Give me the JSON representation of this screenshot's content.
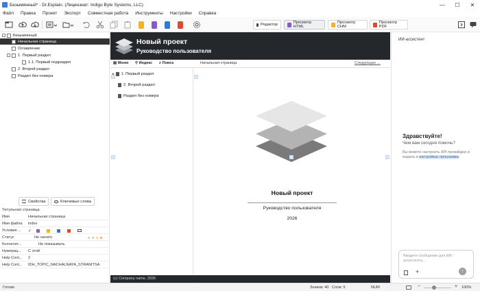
{
  "window": {
    "title": "Безымянный* - Dr.Explain. (Лицензиат: Indigo Byte Systems, LLC)",
    "controls": [
      "—",
      "☐",
      "✕"
    ]
  },
  "menu": [
    "Файл",
    "Правка",
    "Проект",
    "Экспорт",
    "Совместная работа",
    "Инструменты",
    "Настройки",
    "Справка"
  ],
  "toolbar": {
    "icons": [
      "new-project-icon",
      "upload-icon",
      "download-icon",
      "add-topic-icon",
      "add-folder-icon",
      "undo-icon",
      "cut-icon",
      "copy-icon",
      "paste-icon",
      "export-html-icon",
      "export-chm-icon",
      "export-word-icon",
      "export-pdf-icon",
      "settings-gear-icon"
    ],
    "tabs": [
      {
        "label": "Редактор",
        "selected": false
      },
      {
        "label": "Просмотр HTML",
        "selected": true
      },
      {
        "label": "Просмотр CHM",
        "selected": false
      },
      {
        "label": "Просмотр PDF",
        "selected": false
      }
    ]
  },
  "tree": {
    "root": "Безымянный",
    "items": [
      {
        "label": "Начальная страница",
        "selected": true
      },
      {
        "label": "Оглавление",
        "selected": false
      },
      {
        "label": "1. Первый раздел",
        "selected": false
      },
      {
        "label": "1.1. Первый подраздел",
        "selected": false
      },
      {
        "label": "2. Второй раздел",
        "selected": false
      },
      {
        "label": "Раздел без номера",
        "selected": false
      }
    ]
  },
  "propButtons": {
    "props": "Свойства",
    "keywords": "Ключевые слова"
  },
  "props": {
    "header": "Титульная страница",
    "rows": [
      {
        "k": "Имя",
        "v": "Начальная страница"
      },
      {
        "k": "Имя файла",
        "v": "index"
      },
      {
        "k": "Условия ...",
        "v": ""
      },
      {
        "k": "Статус",
        "v": "Не начато"
      },
      {
        "k": "Колонтит...",
        "v": "Не показывать"
      },
      {
        "k": "Нумерац...",
        "v": "С этой"
      },
      {
        "k": "Help Cont...",
        "v": "2"
      },
      {
        "k": "Help Cont...",
        "v": "IDH_TOPIC_NACHALNAYA_STRANITSA"
      }
    ]
  },
  "preview": {
    "bannerTitle": "Новый проект",
    "bannerSubtitle": "Руководство пользователя",
    "navTabs": [
      "Меню",
      "Индекс",
      "Поиск"
    ],
    "breadcrumb": "Начальная страница",
    "next": "Следующая →",
    "sideItems": [
      "1. Первый раздел",
      "2. Второй раздел",
      "Раздел без номера"
    ],
    "coverTitle": "Новый проект",
    "coverSubtitle": "Руководство пользователя",
    "coverYear": "2026",
    "footer": "(c) Company name, 2026"
  },
  "ai": {
    "title": "ИИ-ассистент",
    "greeting": "Здравствуйте!",
    "question": "Чем вам сегодня помочь?",
    "hint": "Вы можете настроить API-провайдер и модель в",
    "hintLink": "настройках программы",
    "hintEnd": ".",
    "placeholder": "Введите сообщение для ИИ-ассистента...",
    "zoom": "100%"
  },
  "status": {
    "ready": "Готово",
    "chars": "Знаков: 40",
    "words": "Слов: 5",
    "num": "NUM"
  }
}
